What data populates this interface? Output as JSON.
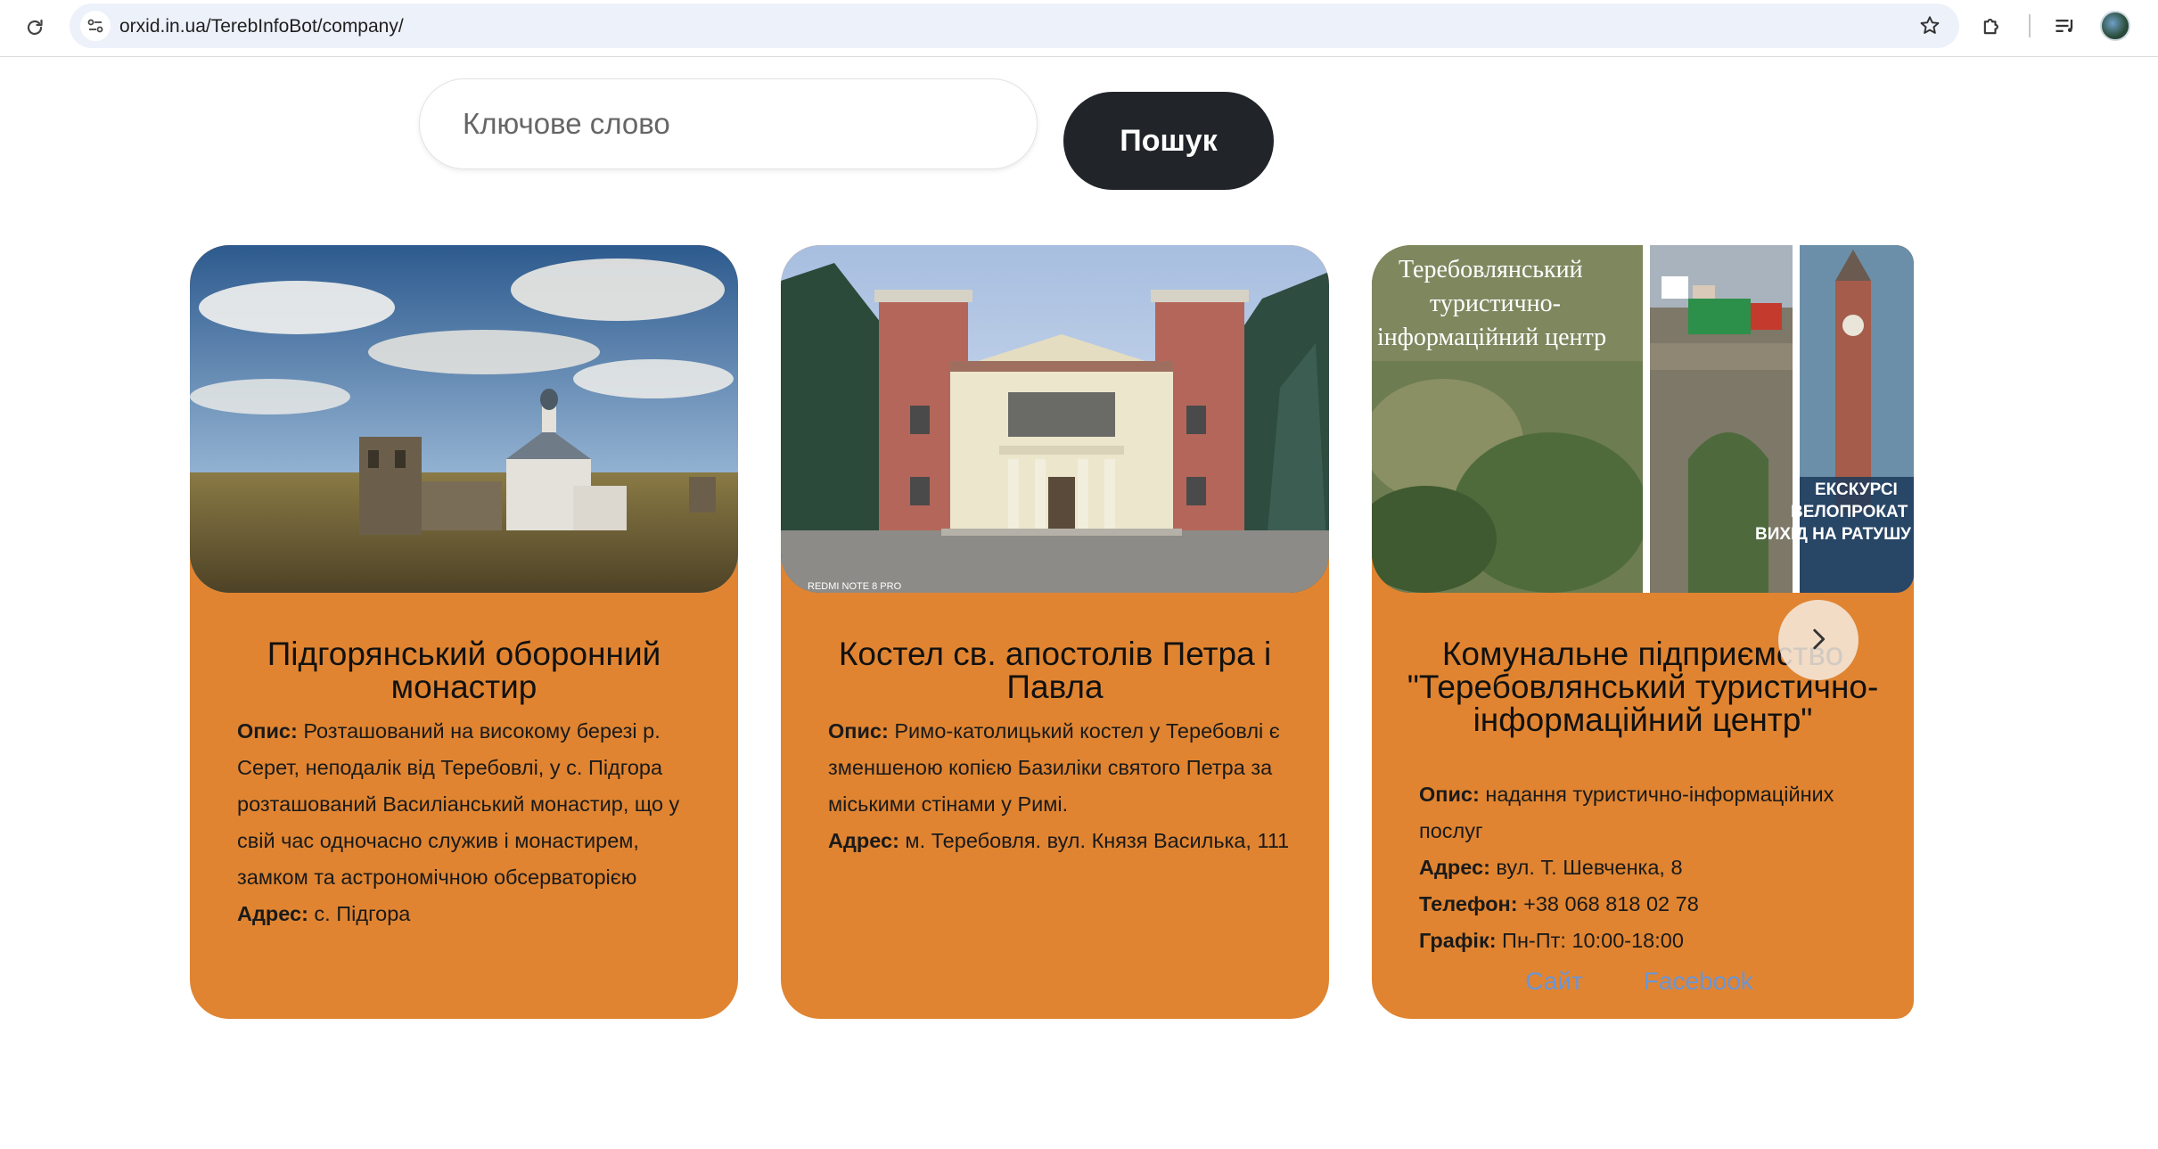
{
  "browser": {
    "url": "orxid.in.ua/TerebInfoBot/company/",
    "icons": [
      "reload-icon",
      "site-info-icon",
      "bookmark-star-icon",
      "extensions-icon",
      "media-controls-icon",
      "profile-avatar"
    ]
  },
  "search": {
    "placeholder": "Ключове слово",
    "button_label": "Пошук"
  },
  "colors": {
    "card_bg": "#e08431",
    "button_bg": "#212529",
    "link": "#6a95d6"
  },
  "cards": [
    {
      "title": "Підгорянський оборонний монастир",
      "desc_label": "Опис:",
      "desc": " Розташований на високому березі р. Серет, неподалік від Теребовлі, у с. Підгора розташований Василіанський монастир, що у свій час одночасно служив і монастирем, замком та астрономічною обсерваторією",
      "addr_label": "Адрес:",
      "addr": " с. Підгора"
    },
    {
      "title": "Костел св. апостолів Петра і Павла",
      "desc_label": "Опис:",
      "desc": " Римо-католицький костел у Теребовлі є зменшеною копією Базиліки святого Петра за міськими стінами у Римі.",
      "addr_label": "Адрес:",
      "addr": " м. Теребовля. вул. Князя Василька, 111",
      "photo_watermark": "REDMI NOTE 8 PRO"
    },
    {
      "title": "Комунальне підприємство \"Теребовлянський туристично-інформаційний центр\"",
      "image_caption": "Теребовлянський туристично-інформаційний центр",
      "image_overlay": [
        "ЕКСКУРСІ",
        "ВЕЛОПРОКАТ",
        "ВИХІД НА РАТУШУ"
      ],
      "desc_label": "Опис:",
      "desc": " надання туристично-інформаційних послуг",
      "addr_label": "Адрес:",
      "addr": " вул. Т. Шевченка, 8",
      "phone_label": "Телефон:",
      "phone": " +38 068 818 02 78",
      "schedule_label": "Графік:",
      "schedule": " Пн-Пт: 10:00-18:00",
      "link_site": "Сайт",
      "link_facebook": "Facebook"
    }
  ]
}
